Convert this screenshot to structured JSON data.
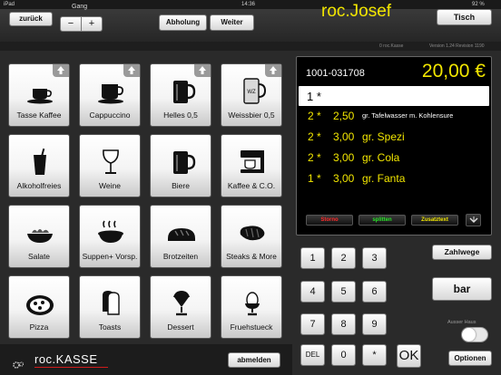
{
  "status_bar": {
    "device": "iPad",
    "time": "14:36",
    "battery": "92 %"
  },
  "header": {
    "back_label": "zurück",
    "gang_label": "Gang",
    "minus": "−",
    "plus": "+",
    "pickup_label": "Abholung",
    "next_label": "Weiter",
    "user_name": "roc.Josef",
    "table_label": "Tisch"
  },
  "info_strip": {
    "app": "0 roc.Kasse",
    "version": "Version 1.24 Revision 1190"
  },
  "tiles": [
    {
      "label": "Tasse Kaffee",
      "icon": "coffee-cup-icon",
      "has_arrow": true
    },
    {
      "label": "Cappuccino",
      "icon": "cappuccino-cup-icon",
      "has_arrow": true
    },
    {
      "label": "Helles 0,5",
      "icon": "beer-mug-icon",
      "has_arrow": true
    },
    {
      "label": "Weissbier 0,5",
      "icon": "wheat-beer-mug-icon",
      "has_arrow": true
    },
    {
      "label": "Alkoholfreies",
      "icon": "soft-drink-glass-icon",
      "has_arrow": false
    },
    {
      "label": "Weine",
      "icon": "wine-glass-icon",
      "has_arrow": false
    },
    {
      "label": "Biere",
      "icon": "beer-icon",
      "has_arrow": false
    },
    {
      "label": "Kaffee & C.O.",
      "icon": "coffee-machine-icon",
      "has_arrow": false
    },
    {
      "label": "Salate",
      "icon": "salad-bowl-icon",
      "has_arrow": false
    },
    {
      "label": "Suppen+ Vorsp.",
      "icon": "soup-bowl-icon",
      "has_arrow": false
    },
    {
      "label": "Brotzeiten",
      "icon": "bread-icon",
      "has_arrow": false
    },
    {
      "label": "Steaks & More",
      "icon": "steak-icon",
      "has_arrow": false
    },
    {
      "label": "Pizza",
      "icon": "pizza-icon",
      "has_arrow": false
    },
    {
      "label": "Toasts",
      "icon": "toast-icon",
      "has_arrow": false
    },
    {
      "label": "Dessert",
      "icon": "ice-cream-icon",
      "has_arrow": false
    },
    {
      "label": "Fruehstueck",
      "icon": "egg-cup-icon",
      "has_arrow": false
    }
  ],
  "order": {
    "number": "1001-031708",
    "total": "20,00 €",
    "input_line": "1 *",
    "items": [
      {
        "qty": "2 *",
        "price": "2,50",
        "name": "gr. Tafelwasser m. Kohlensure",
        "selected": true
      },
      {
        "qty": "2 *",
        "price": "3,00",
        "name": "gr. Spezi",
        "selected": false
      },
      {
        "qty": "2 *",
        "price": "3,00",
        "name": "gr. Cola",
        "selected": false
      },
      {
        "qty": "1 *",
        "price": "3,00",
        "name": "gr. Fanta",
        "selected": false
      }
    ],
    "storno_label": "Storno",
    "split_label": "splitten",
    "extra_label": "Zusatztext"
  },
  "keypad": {
    "keys": [
      "1",
      "2",
      "3",
      "4",
      "5",
      "6",
      "7",
      "8",
      "9",
      "DEL",
      "0",
      "*"
    ],
    "ok_label": "OK"
  },
  "right_buttons": {
    "payways_label": "Zahlwege",
    "cash_label": "bar",
    "outside_label": "Ausser Haus",
    "options_label": "Optionen"
  },
  "footer": {
    "logo_text": "roc.KASSE",
    "logout_label": "abmelden"
  },
  "colors": {
    "display_text": "#f2e600",
    "storno": "#ff2a2a",
    "split": "#29e629",
    "extra": "#f2e600"
  }
}
